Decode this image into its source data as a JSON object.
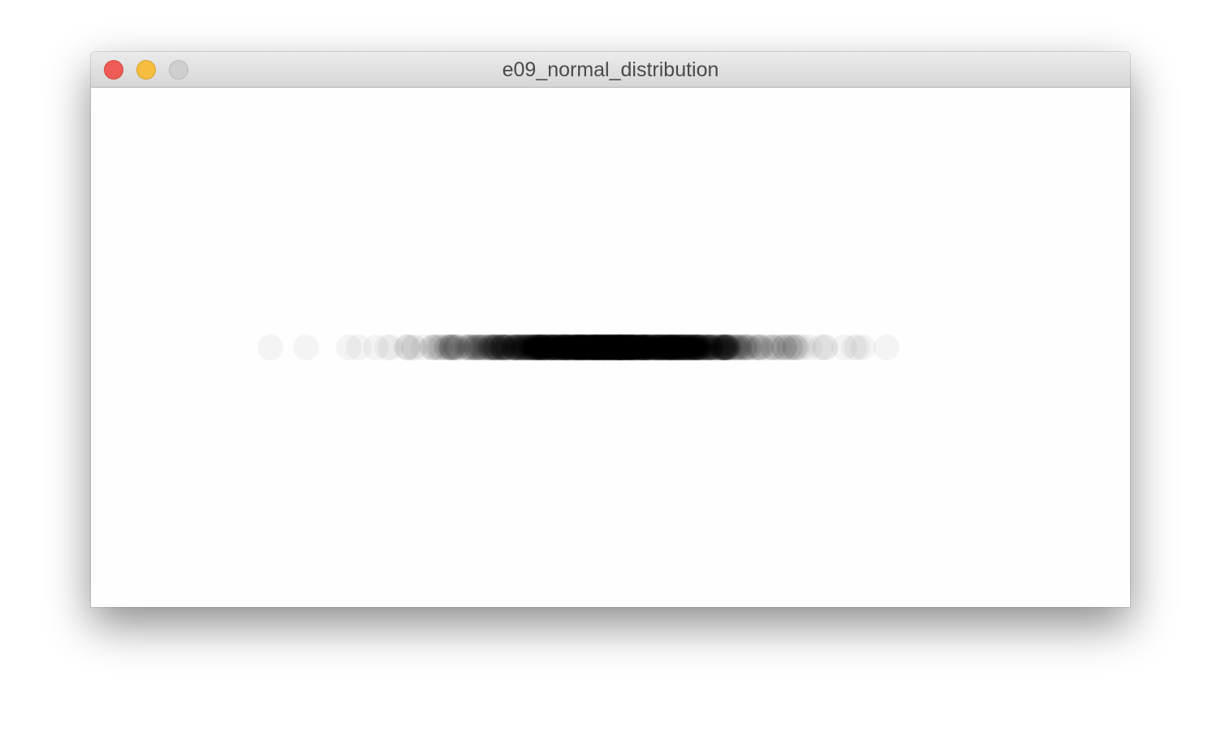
{
  "window": {
    "title": "e09_normal_distribution",
    "controls": {
      "close": "close-button",
      "minimize": "minimize-button",
      "zoom": "zoom-button"
    }
  },
  "sketch": {
    "background": "#fefefe",
    "dot_color": "#000000",
    "dot_alpha": 0.04
  }
}
